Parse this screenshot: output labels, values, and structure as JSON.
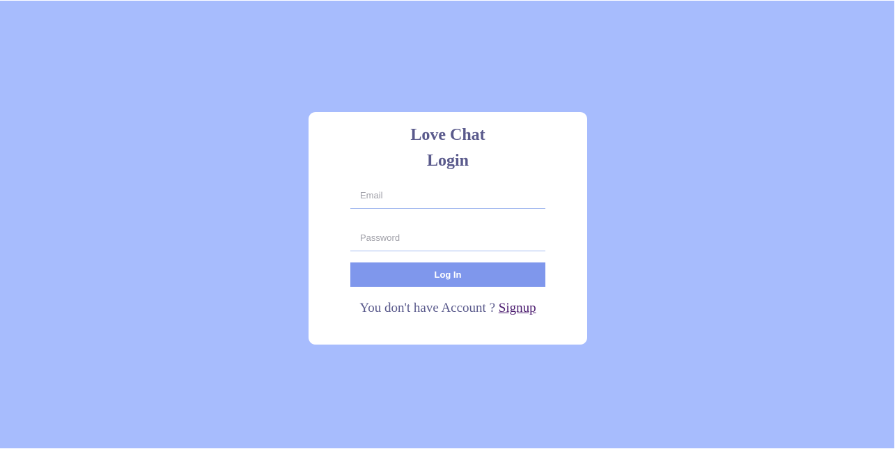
{
  "app": {
    "title": "Love Chat"
  },
  "form": {
    "title": "Login",
    "email": {
      "value": "",
      "placeholder": "Email"
    },
    "password": {
      "value": "",
      "placeholder": "Password"
    },
    "submit_label": "Log In"
  },
  "footer": {
    "prompt": "You don't have Account ? ",
    "signup_label": "Signup"
  },
  "colors": {
    "background": "#a7bcfd",
    "card": "#ffffff",
    "heading": "#5a5a8c",
    "button": "#7f97ec",
    "button_text": "#ffffff",
    "input_underline": "#a7bcf0",
    "link": "#4a1a6e"
  }
}
